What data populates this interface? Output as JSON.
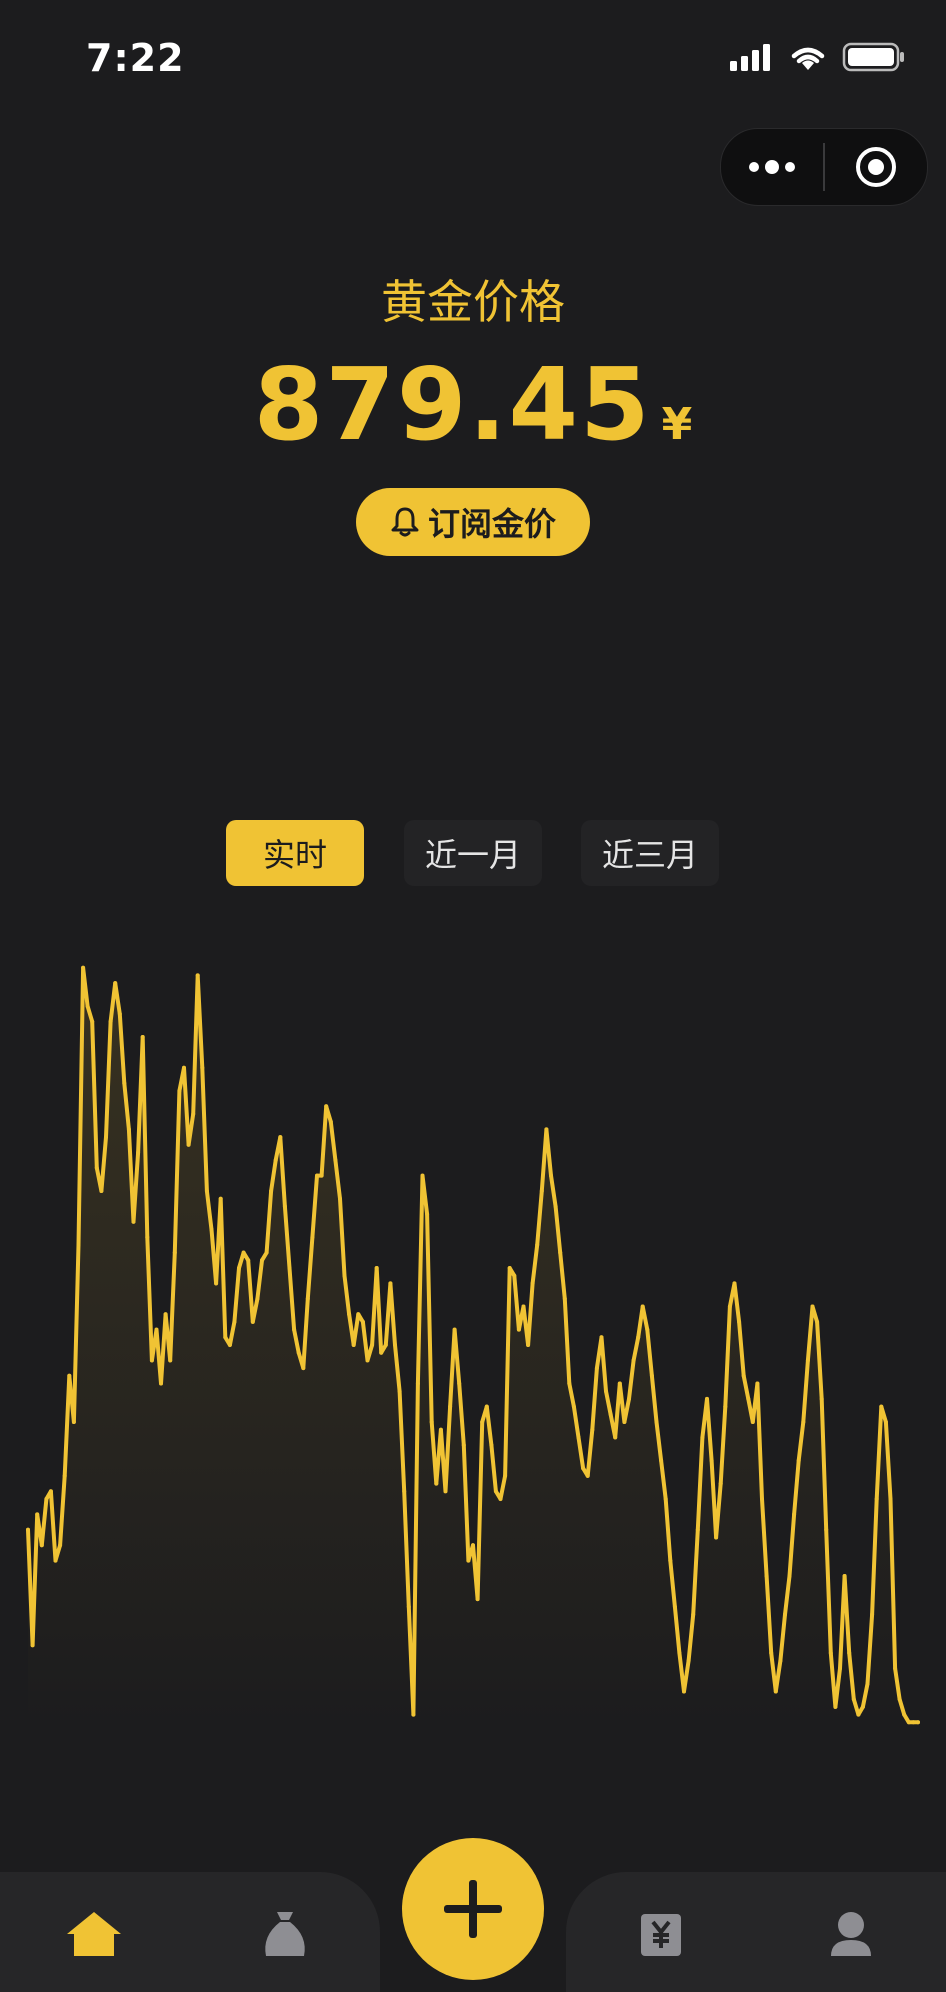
{
  "status": {
    "time": "7:22"
  },
  "header": {
    "title": "黄金价格",
    "price": "879.45",
    "unit": "¥",
    "subscribe_label": "订阅金价"
  },
  "tabs": [
    {
      "label": "实时",
      "active": true
    },
    {
      "label": "近一月",
      "active": false
    },
    {
      "label": "近三月",
      "active": false
    }
  ],
  "colors": {
    "accent": "#f0c334",
    "background": "#1c1c1e",
    "tab_bg": "#232325"
  },
  "nav": {
    "items": [
      "home-icon",
      "money-bag-icon",
      "add-icon",
      "yuan-receipt-icon",
      "user-icon"
    ]
  },
  "chart_data": {
    "type": "line",
    "title": "",
    "xlabel": "",
    "ylabel": "",
    "grid": false,
    "x": [
      0,
      1,
      2,
      3,
      4,
      5,
      6,
      7,
      8,
      9,
      10,
      11,
      12,
      13,
      14,
      15,
      16,
      17,
      18,
      19,
      20,
      21,
      22,
      23,
      24,
      25,
      26,
      27,
      28,
      29,
      30,
      31,
      32,
      33,
      34,
      35,
      36,
      37,
      38,
      39,
      40,
      41,
      42,
      43,
      44,
      45,
      46,
      47,
      48,
      49,
      50,
      51,
      52,
      53,
      54,
      55,
      56,
      57,
      58,
      59,
      60,
      61,
      62,
      63,
      64,
      65,
      66,
      67,
      68,
      69,
      70,
      71,
      72,
      73,
      74,
      75,
      76,
      77,
      78,
      79,
      80,
      81,
      82,
      83,
      84,
      85,
      86,
      87,
      88,
      89,
      90,
      91,
      92,
      93,
      94,
      95,
      96,
      97,
      98,
      99,
      100,
      101,
      102,
      103,
      104,
      105,
      106,
      107,
      108,
      109,
      110,
      111,
      112,
      113,
      114,
      115,
      116,
      117,
      118,
      119,
      120,
      121,
      122,
      123,
      124,
      125,
      126,
      127,
      128,
      129,
      130,
      131,
      132,
      133,
      134,
      135,
      136,
      137,
      138,
      139,
      140,
      141,
      142,
      143,
      144,
      145,
      146,
      147,
      148,
      149,
      150,
      151,
      152,
      153,
      154,
      155,
      156,
      157,
      158,
      159,
      160,
      161,
      162,
      163,
      164,
      165,
      166,
      167,
      168,
      169,
      170,
      171,
      172,
      173,
      174,
      175,
      176,
      177,
      178,
      179,
      180,
      181,
      182,
      183,
      184,
      185,
      186,
      187,
      188,
      189,
      190,
      191,
      192,
      193,
      194
    ],
    "values": [
      0.26,
      0.11,
      0.28,
      0.24,
      0.3,
      0.31,
      0.22,
      0.24,
      0.33,
      0.46,
      0.4,
      0.63,
      0.99,
      0.94,
      0.92,
      0.73,
      0.7,
      0.77,
      0.92,
      0.97,
      0.93,
      0.84,
      0.78,
      0.66,
      0.75,
      0.9,
      0.64,
      0.48,
      0.52,
      0.45,
      0.54,
      0.48,
      0.62,
      0.83,
      0.86,
      0.76,
      0.8,
      0.98,
      0.86,
      0.7,
      0.65,
      0.58,
      0.69,
      0.51,
      0.5,
      0.53,
      0.6,
      0.62,
      0.61,
      0.53,
      0.56,
      0.61,
      0.62,
      0.7,
      0.74,
      0.77,
      0.68,
      0.6,
      0.52,
      0.49,
      0.47,
      0.56,
      0.64,
      0.72,
      0.72,
      0.81,
      0.79,
      0.74,
      0.69,
      0.59,
      0.54,
      0.5,
      0.54,
      0.53,
      0.48,
      0.5,
      0.6,
      0.49,
      0.5,
      0.58,
      0.5,
      0.44,
      0.31,
      0.16,
      0.02,
      0.45,
      0.72,
      0.67,
      0.4,
      0.32,
      0.39,
      0.31,
      0.42,
      0.52,
      0.45,
      0.37,
      0.22,
      0.24,
      0.17,
      0.4,
      0.42,
      0.37,
      0.31,
      0.3,
      0.33,
      0.6,
      0.59,
      0.52,
      0.55,
      0.5,
      0.58,
      0.63,
      0.7,
      0.78,
      0.72,
      0.68,
      0.62,
      0.56,
      0.45,
      0.42,
      0.38,
      0.34,
      0.33,
      0.39,
      0.47,
      0.51,
      0.44,
      0.41,
      0.38,
      0.45,
      0.4,
      0.43,
      0.48,
      0.51,
      0.55,
      0.52,
      0.46,
      0.4,
      0.35,
      0.3,
      0.22,
      0.16,
      0.1,
      0.05,
      0.09,
      0.15,
      0.26,
      0.38,
      0.43,
      0.35,
      0.25,
      0.32,
      0.42,
      0.55,
      0.58,
      0.53,
      0.46,
      0.43,
      0.4,
      0.45,
      0.3,
      0.2,
      0.1,
      0.05,
      0.09,
      0.15,
      0.2,
      0.28,
      0.35,
      0.4,
      0.48,
      0.55,
      0.53,
      0.43,
      0.26,
      0.1,
      0.03,
      0.08,
      0.2,
      0.1,
      0.04,
      0.02,
      0.03,
      0.06,
      0.15,
      0.3,
      0.42,
      0.4,
      0.3,
      0.08,
      0.04,
      0.02,
      0.01,
      0.01,
      0.01
    ]
  }
}
